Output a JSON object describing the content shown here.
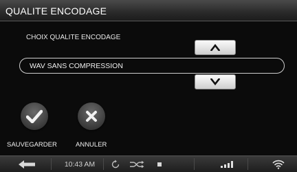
{
  "header": {
    "title": "QUALITE ENCODAGE"
  },
  "setting": {
    "label": "CHOIX QUALITE ENCODAGE",
    "value": "WAV SANS COMPRESSION"
  },
  "actions": {
    "save_label": "SAUVEGARDER",
    "cancel_label": "ANNULER"
  },
  "status_bar": {
    "time": "10:43 AM",
    "icons": [
      "back-arrow-icon",
      "repeat-icon",
      "shuffle-icon",
      "stop-icon",
      "signal-bars-icon",
      "wifi-icon"
    ]
  },
  "colors": {
    "background": "#0b0b0b",
    "bar": "#2a2a2a",
    "button_face": "#e6e6e6",
    "text": "#ffffff"
  }
}
